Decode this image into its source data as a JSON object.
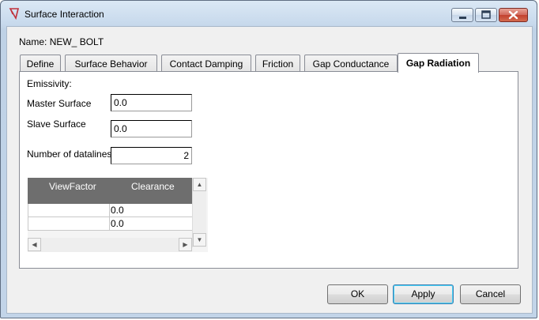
{
  "window": {
    "title": "Surface Interaction",
    "app_icon": "surface-interaction-icon",
    "controls": {
      "minimize": "minimize-icon",
      "maximize": "maximize-icon",
      "close": "close-icon"
    }
  },
  "name_row": {
    "label": "Name:",
    "value": "NEW_ BOLT"
  },
  "tabs": [
    {
      "label": "Define",
      "active": false
    },
    {
      "label": "Surface Behavior",
      "active": false
    },
    {
      "label": "Contact Damping",
      "active": false
    },
    {
      "label": "Friction",
      "active": false
    },
    {
      "label": "Gap Conductance",
      "active": false
    },
    {
      "label": "Gap Radiation",
      "active": true
    }
  ],
  "panel": {
    "emissivity_label": "Emissivity:",
    "master_surface": {
      "label": "Master Surface",
      "value": "0.0"
    },
    "slave_surface": {
      "label": "Slave Surface",
      "value": "0.0"
    },
    "datalines": {
      "label": "Number of datalines:",
      "value": "2"
    },
    "table": {
      "columns": [
        "ViewFactor",
        "Clearance"
      ],
      "rows": [
        {
          "view_factor": "",
          "clearance": "0.0"
        },
        {
          "view_factor": "",
          "clearance": "0.0"
        }
      ]
    }
  },
  "buttons": {
    "ok": "OK",
    "apply": "Apply",
    "cancel": "Cancel"
  }
}
